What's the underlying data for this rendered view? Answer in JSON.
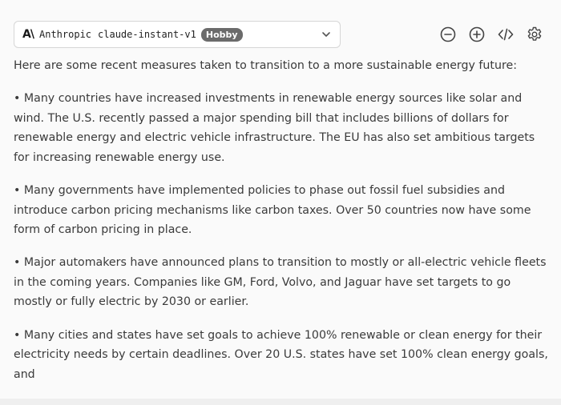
{
  "header": {
    "provider": "Anthropic",
    "model": "claude-instant-v1",
    "badge": "Hobby"
  },
  "toolbar": {
    "icons": [
      "minus-circle-icon",
      "plus-circle-icon",
      "code-icon",
      "gear-icon"
    ]
  },
  "response": {
    "intro": "Here are some recent measures taken to transition to a more sustainable energy future:",
    "bullets": [
      "• Many countries have increased investments in renewable energy sources like solar and wind. The U.S. recently passed a major spending bill that includes billions of dollars for renewable energy and electric vehicle infrastructure. The EU has also set ambitious targets for increasing renewable energy use.",
      "• Many governments have implemented policies to phase out fossil fuel subsidies and introduce carbon pricing mechanisms like carbon taxes. Over 50 countries now have some form of carbon pricing in place.",
      "• Major automakers have announced plans to transition to mostly or all-electric vehicle fleets in the coming years. Companies like GM, Ford, Volvo, and Jaguar have set targets to go mostly or fully electric by 2030 or earlier.",
      "• Many cities and states have set goals to achieve 100% renewable or clean energy for their electricity needs by certain deadlines. Over 20 U.S. states have set 100% clean energy goals, and"
    ]
  }
}
